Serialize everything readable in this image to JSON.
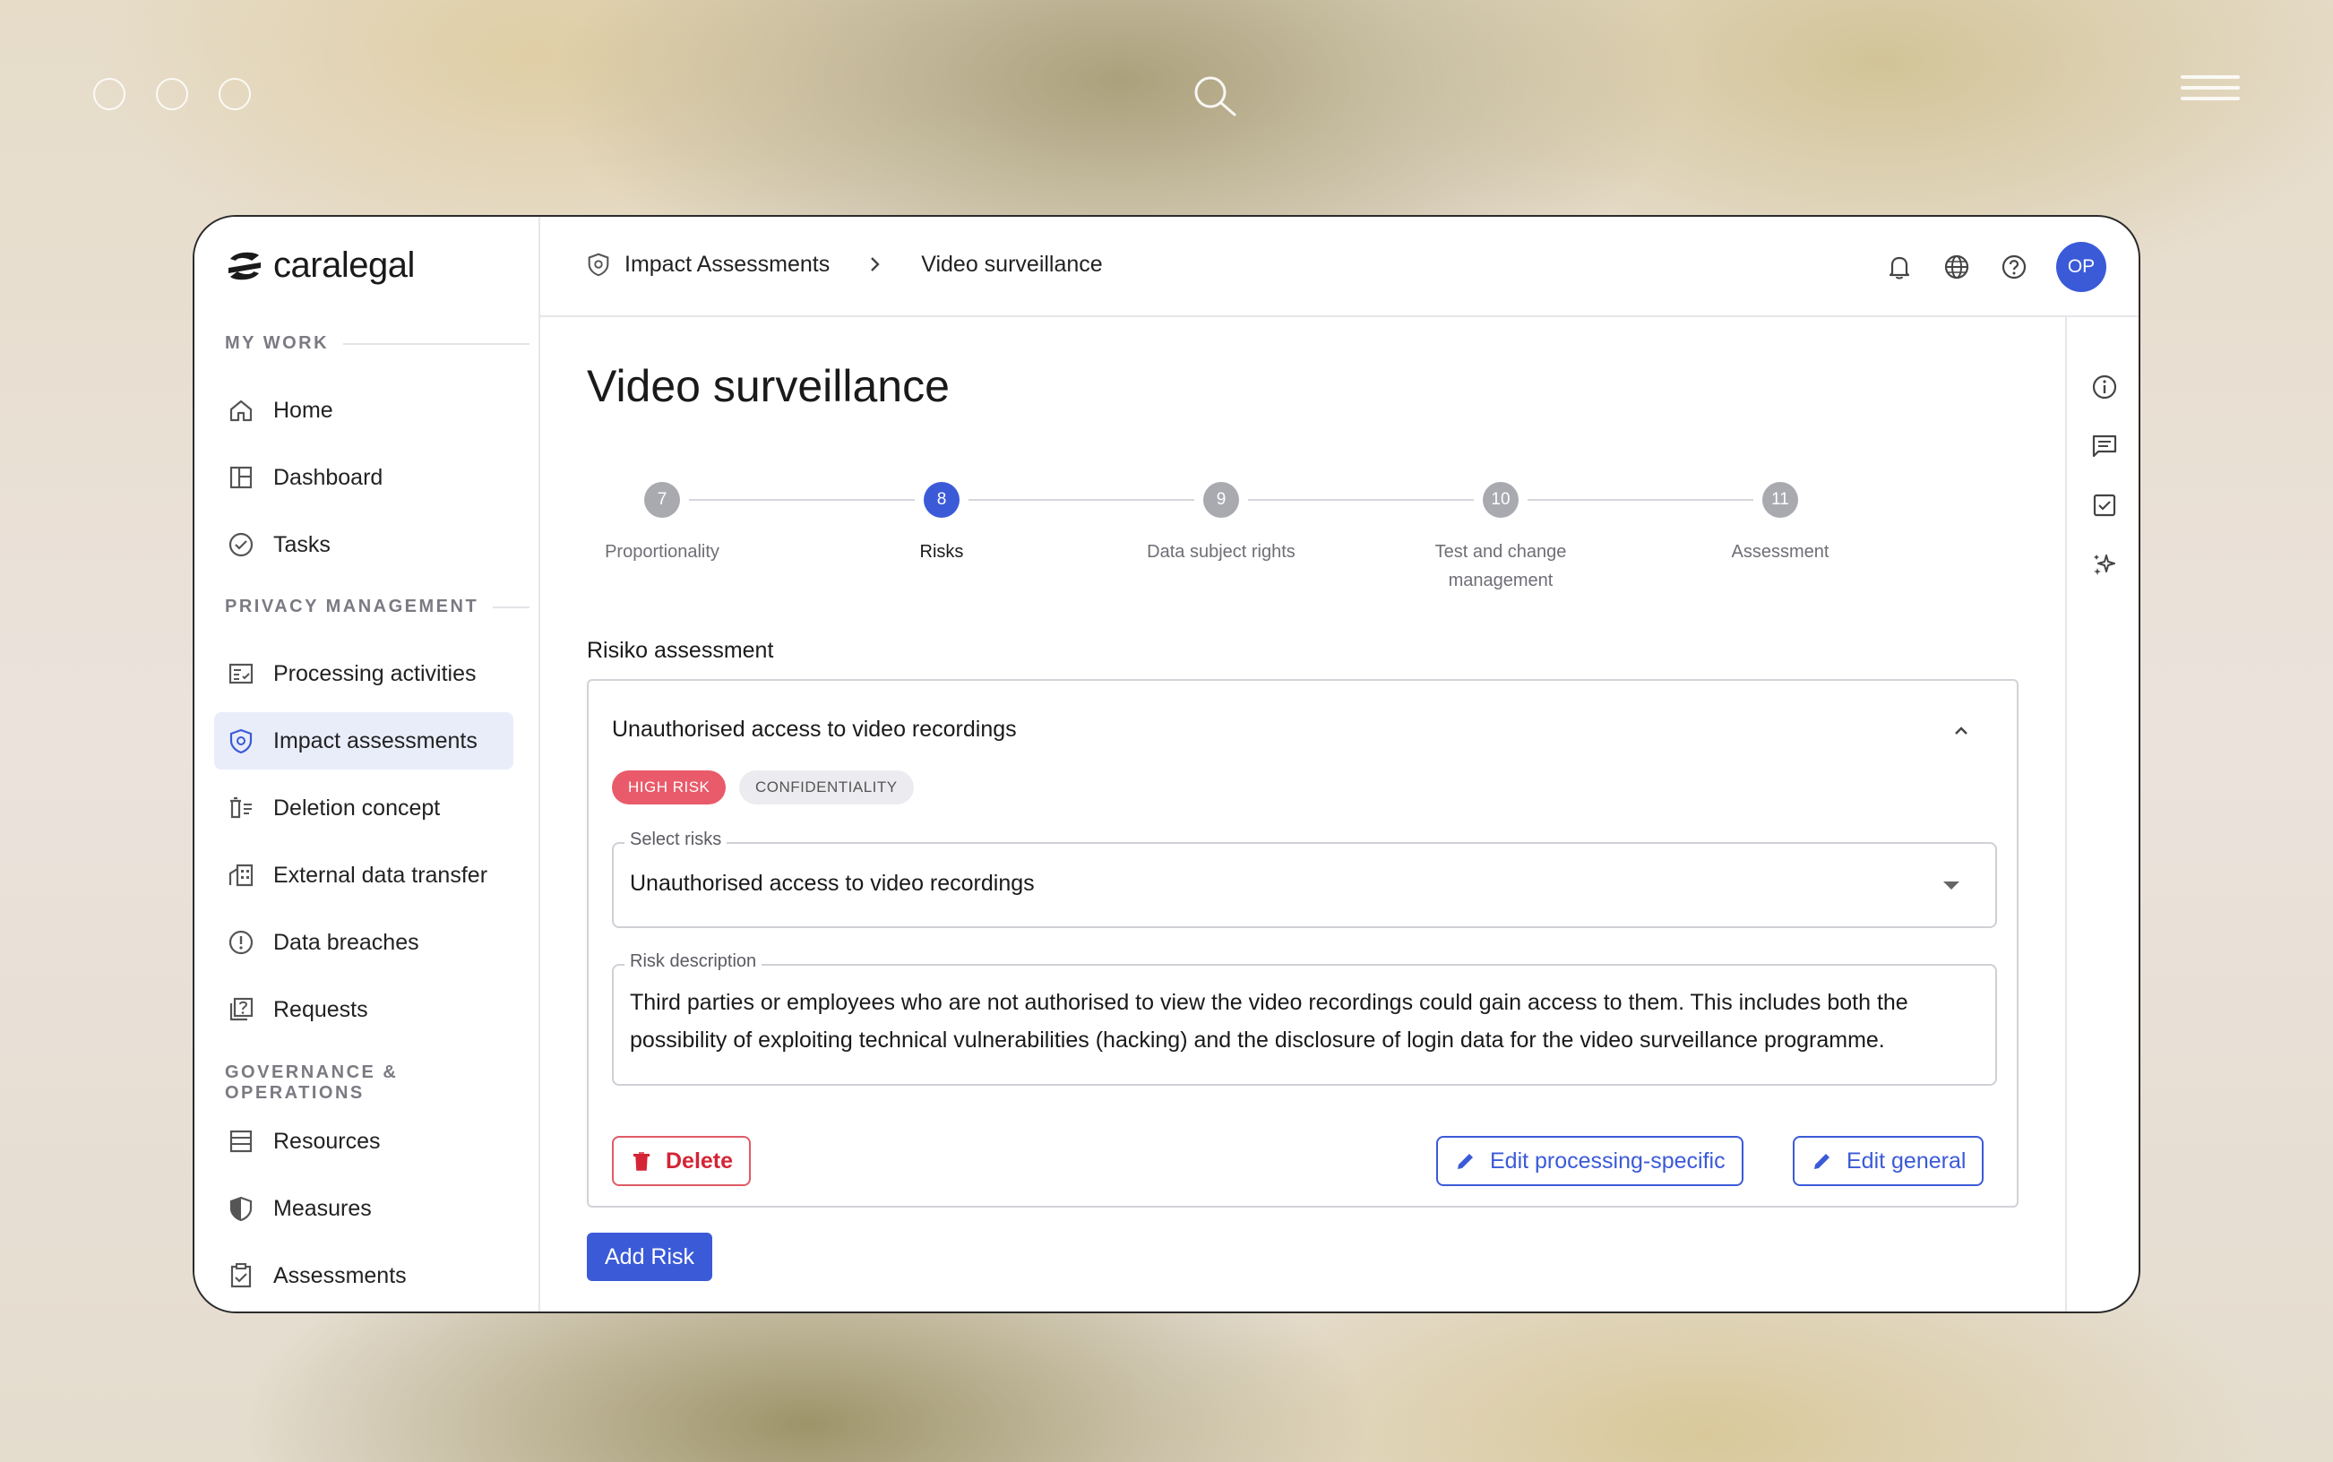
{
  "app": {
    "logo_text": "caralegal"
  },
  "sidebar": {
    "sections": [
      {
        "title": "MY WORK"
      },
      {
        "title": "PRIVACY MANAGEMENT"
      },
      {
        "title": "GOVERNANCE & OPERATIONS"
      }
    ],
    "items": [
      {
        "label": "Home",
        "icon": "home-icon"
      },
      {
        "label": "Dashboard",
        "icon": "dashboard-icon"
      },
      {
        "label": "Tasks",
        "icon": "check-circle-icon"
      },
      {
        "label": "Processing activities",
        "icon": "list-check-icon"
      },
      {
        "label": "Impact assessments",
        "icon": "shield-icon",
        "active": true
      },
      {
        "label": "Deletion concept",
        "icon": "trash-list-icon"
      },
      {
        "label": "External data transfer",
        "icon": "building-icon"
      },
      {
        "label": "Data breaches",
        "icon": "alert-circle-icon"
      },
      {
        "label": "Requests",
        "icon": "question-box-icon"
      },
      {
        "label": "Resources",
        "icon": "rows-icon"
      },
      {
        "label": "Measures",
        "icon": "shield-half-icon"
      },
      {
        "label": "Assessments",
        "icon": "clipboard-check-icon"
      }
    ]
  },
  "header": {
    "breadcrumb": [
      "Impact Assessments",
      "Video surveillance"
    ],
    "avatar_initials": "OP"
  },
  "main": {
    "title": "Video surveillance",
    "steps": [
      {
        "number": "7",
        "label": "Proportionality"
      },
      {
        "number": "8",
        "label": "Risks",
        "active": true
      },
      {
        "number": "9",
        "label": "Data subject rights"
      },
      {
        "number": "10",
        "label": "Test and change management"
      },
      {
        "number": "11",
        "label": "Assessment"
      }
    ],
    "section_label": "Risiko assessment",
    "risk": {
      "title": "Unauthorised access to video recordings",
      "chips": [
        "HIGH RISK",
        "CONFIDENTIALITY"
      ],
      "select_legend": "Select risks",
      "select_value": "Unauthorised access to video recordings",
      "desc_legend": "Risk description",
      "desc_value": "Third parties or employees who are not authorised to view the video recordings could gain access to them. This includes both the possibility of exploiting technical vulnerabilities (hacking) and the disclosure of login data for the video surveillance programme.",
      "delete_label": "Delete",
      "edit_specific_label": "Edit processing-specific",
      "edit_general_label": "Edit general"
    },
    "add_risk_label": "Add Risk"
  },
  "colors": {
    "accent": "#3b5ad8",
    "danger": "#d42435",
    "high_risk_chip": "#e95b6a"
  }
}
